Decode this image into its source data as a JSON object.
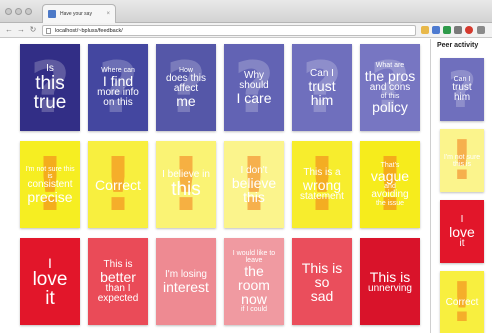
{
  "browser": {
    "tab_title": "Have your say",
    "tab_close": "×",
    "url": "localhost/~bpluss/feedback/",
    "back_glyph": "←",
    "forward_glyph": "→",
    "reload_glyph": "↻",
    "icons": [
      "back-icon",
      "forward-icon",
      "reload-icon",
      "page-icon",
      "star-icon",
      "extension-icon",
      "menu-icon"
    ]
  },
  "colors": {
    "question_cards": "#3c3d97",
    "exclaim_cards": "#f6ee22",
    "emotion_cards": "#e2162a",
    "exclaim_glyph": "#f27819"
  },
  "cards": {
    "questions": [
      {
        "lines": [
          "Is",
          "this",
          "true"
        ]
      },
      {
        "lines": [
          "Where can",
          "I find",
          "more info",
          "on this"
        ]
      },
      {
        "lines": [
          "How",
          "does this",
          "affect",
          "me"
        ]
      },
      {
        "lines": [
          "Why",
          "should",
          "I care"
        ]
      },
      {
        "lines": [
          "Can I",
          "trust",
          "him"
        ]
      },
      {
        "lines": [
          "What are",
          "the pros",
          "and cons",
          "of this",
          "policy"
        ]
      }
    ],
    "statements": [
      {
        "lines": [
          "I'm not sure this is",
          "consistent",
          "precise"
        ]
      },
      {
        "lines": [
          "Correct"
        ]
      },
      {
        "lines": [
          "I believe in",
          "this"
        ]
      },
      {
        "lines": [
          "I don't",
          "believe",
          "this"
        ]
      },
      {
        "lines": [
          "This is a",
          "wrong",
          "statement"
        ]
      },
      {
        "lines": [
          "That's",
          "vague",
          "and",
          "avoiding",
          "the issue"
        ]
      }
    ],
    "emotions": [
      {
        "lines": [
          "I",
          "love",
          "it"
        ]
      },
      {
        "lines": [
          "This is",
          "better",
          "than I",
          "expected"
        ]
      },
      {
        "lines": [
          "I'm losing",
          "interest"
        ]
      },
      {
        "lines": [
          "I would like to leave",
          "the room",
          "now",
          "if I could"
        ]
      },
      {
        "lines": [
          "This is",
          "so",
          "sad"
        ]
      },
      {
        "lines": [
          "This is",
          "unnerving"
        ]
      }
    ],
    "question_glyph": "?",
    "exclaim_glyph": "!"
  },
  "sidebar": {
    "title": "Peer activity",
    "items": [
      {
        "lines": [
          "Can I",
          "trust",
          "him"
        ]
      },
      {
        "lines": [
          "I'm not sure",
          "this is"
        ]
      },
      {
        "lines": [
          "I",
          "love",
          "it"
        ]
      },
      {
        "lines": [
          "Correct"
        ]
      }
    ]
  }
}
